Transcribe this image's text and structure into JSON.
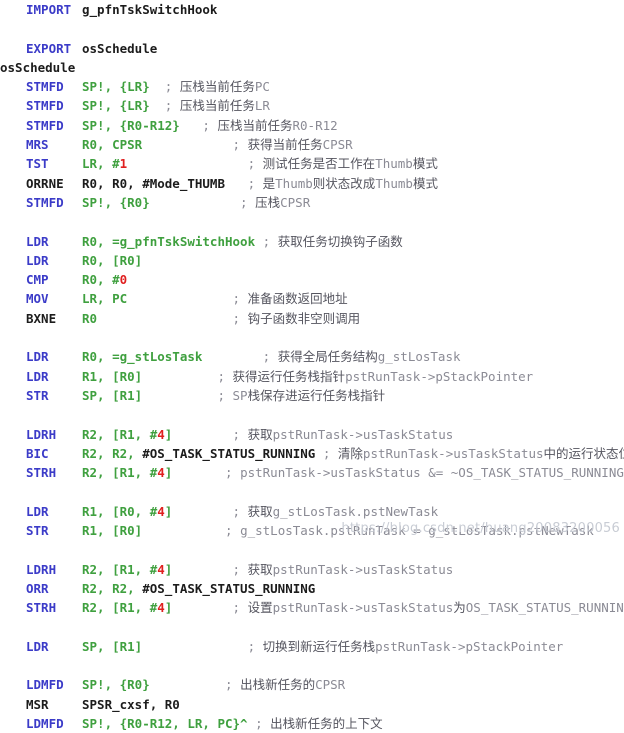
{
  "editor": {
    "language": "ARM Assembly",
    "colors": {
      "keyword": "#3b3bc8",
      "operand": "#3fa03f",
      "number": "#e02020",
      "comment": "#8b8b95",
      "comment_cjk": "#55555f",
      "plain": "#1c1c1c",
      "background": "#ffffff",
      "watermark": "#c8ccd4"
    },
    "watermark": "https://blog.csdn.net/huang20083200056"
  },
  "lines": [
    {
      "kind": "code",
      "indent": 1,
      "mnemonic": "IMPORT",
      "operand_plain": "g_pfnTskSwitchHook",
      "comment": ""
    },
    {
      "kind": "blank"
    },
    {
      "kind": "code",
      "indent": 1,
      "mnemonic": "EXPORT",
      "operand_plain": "osSchedule",
      "comment": ""
    },
    {
      "kind": "label",
      "label": "osSchedule"
    },
    {
      "kind": "code",
      "indent": 1,
      "mnemonic": "STMFD",
      "operand": "SP!, {LR}",
      "pad": 2,
      "comment": "; 压栈当前任务PC"
    },
    {
      "kind": "code",
      "indent": 1,
      "mnemonic": "STMFD",
      "operand": "SP!, {LR}",
      "pad": 2,
      "comment": "; 压栈当前任务LR"
    },
    {
      "kind": "code",
      "indent": 1,
      "mnemonic": "STMFD",
      "operand": "SP!, {R0-R12}",
      "pad": 3,
      "comment": "; 压栈当前任务R0-R12"
    },
    {
      "kind": "code",
      "indent": 1,
      "mnemonic": "MRS",
      "operand": "R0, CPSR",
      "pad": 12,
      "comment": "; 获得当前任务CPSR"
    },
    {
      "kind": "code",
      "indent": 1,
      "mnemonic": "TST",
      "operand": "LR, #",
      "number": "1",
      "pad": 16,
      "comment": "; 测试任务是否工作在Thumb模式"
    },
    {
      "kind": "code",
      "indent": 1,
      "mnemonic_plain": "ORRNE",
      "operand_plain": "R0, R0, #Mode_THUMB",
      "pad": 3,
      "comment": "; 是Thumb则状态改成Thumb模式"
    },
    {
      "kind": "code",
      "indent": 1,
      "mnemonic": "STMFD",
      "operand": "SP!, {R0}",
      "pad": 12,
      "comment": "; 压栈CPSR"
    },
    {
      "kind": "blank"
    },
    {
      "kind": "code",
      "indent": 1,
      "mnemonic": "LDR",
      "operand": "R0, =g_pfnTskSwitchHook",
      "pad": 1,
      "comment": "; 获取任务切换钩子函数"
    },
    {
      "kind": "code",
      "indent": 1,
      "mnemonic": "LDR",
      "operand": "R0, [R0]",
      "pad": 0,
      "comment": ""
    },
    {
      "kind": "code",
      "indent": 1,
      "mnemonic": "CMP",
      "operand": "R0, #",
      "number": "0",
      "pad": 0,
      "comment": ""
    },
    {
      "kind": "code",
      "indent": 1,
      "mnemonic": "MOV",
      "operand": "LR, PC",
      "pad": 14,
      "comment": "; 准备函数返回地址"
    },
    {
      "kind": "code",
      "indent": 1,
      "mnemonic_plain": "BXNE",
      "operand": "R0",
      "pad": 18,
      "comment": "; 钩子函数非空则调用"
    },
    {
      "kind": "blank"
    },
    {
      "kind": "code",
      "indent": 1,
      "mnemonic": "LDR",
      "operand": "R0, =g_stLosTask",
      "pad": 8,
      "comment": "; 获得全局任务结构g_stLosTask"
    },
    {
      "kind": "code",
      "indent": 1,
      "mnemonic": "LDR",
      "operand": "R1, [R0]",
      "pad": 10,
      "comment": "; 获得运行任务栈指针pstRunTask->pStackPointer"
    },
    {
      "kind": "code",
      "indent": 1,
      "mnemonic": "STR",
      "operand": "SP, [R1]",
      "pad": 10,
      "comment": "; SP栈保存进运行任务栈指针"
    },
    {
      "kind": "blank"
    },
    {
      "kind": "code",
      "indent": 1,
      "mnemonic": "LDRH",
      "operand": "R2, [R1, #",
      "number": "4",
      "operand_tail": "]",
      "pad": 8,
      "comment": "; 获取pstRunTask->usTaskStatus"
    },
    {
      "kind": "code",
      "indent": 1,
      "mnemonic": "BIC",
      "operand": "R2, R2, ",
      "plain_tail": "#OS_TASK_STATUS_RUNNING",
      "pad": 1,
      "comment": "; 清除pstRunTask->usTaskStatus中的运行状态位"
    },
    {
      "kind": "code",
      "indent": 1,
      "mnemonic": "STRH",
      "operand": "R2, [R1, #",
      "number": "4",
      "operand_tail": "]",
      "pad": 7,
      "comment": "; pstRunTask->usTaskStatus &= ~OS_TASK_STATUS_RUNNING"
    },
    {
      "kind": "blank"
    },
    {
      "kind": "code",
      "indent": 1,
      "mnemonic": "LDR",
      "operand": "R1, [R0, #",
      "number": "4",
      "operand_tail": "]",
      "pad": 8,
      "comment": "; 获取g_stLosTask.pstNewTask"
    },
    {
      "kind": "code",
      "indent": 1,
      "mnemonic": "STR",
      "operand": "R1, [R0]",
      "pad": 11,
      "comment": "; g_stLosTask.pstRunTask = g_stLosTask.pstNewTask"
    },
    {
      "kind": "blank"
    },
    {
      "kind": "code",
      "indent": 1,
      "mnemonic": "LDRH",
      "operand": "R2, [R1, #",
      "number": "4",
      "operand_tail": "]",
      "pad": 8,
      "comment": "; 获取pstRunTask->usTaskStatus"
    },
    {
      "kind": "code",
      "indent": 1,
      "mnemonic": "ORR",
      "operand": "R2, R2, ",
      "plain_tail": "#OS_TASK_STATUS_RUNNING",
      "pad": 0,
      "comment": ""
    },
    {
      "kind": "code",
      "indent": 1,
      "mnemonic": "STRH",
      "operand": "R2, [R1, #",
      "number": "4",
      "operand_tail": "]",
      "pad": 8,
      "comment": "; 设置pstRunTask->usTaskStatus为OS_TASK_STATUS_RUNNING"
    },
    {
      "kind": "blank"
    },
    {
      "kind": "code",
      "indent": 1,
      "mnemonic": "LDR",
      "operand": "SP, [R1]",
      "pad": 14,
      "comment": "; 切换到新运行任务栈pstRunTask->pStackPointer"
    },
    {
      "kind": "blank"
    },
    {
      "kind": "code",
      "indent": 1,
      "mnemonic": "LDMFD",
      "operand": "SP!, {R0}",
      "pad": 10,
      "comment": "; 出栈新任务的CPSR"
    },
    {
      "kind": "code",
      "indent": 1,
      "mnemonic_plain": "MSR",
      "operand_plain": "SPSR_cxsf, R0",
      "pad": 0,
      "comment": ""
    },
    {
      "kind": "code",
      "indent": 1,
      "mnemonic": "LDMFD",
      "operand": "SP!, {R0-R12, LR, PC}^",
      "pad": 1,
      "comment": "; 出栈新任务的上下文"
    }
  ]
}
